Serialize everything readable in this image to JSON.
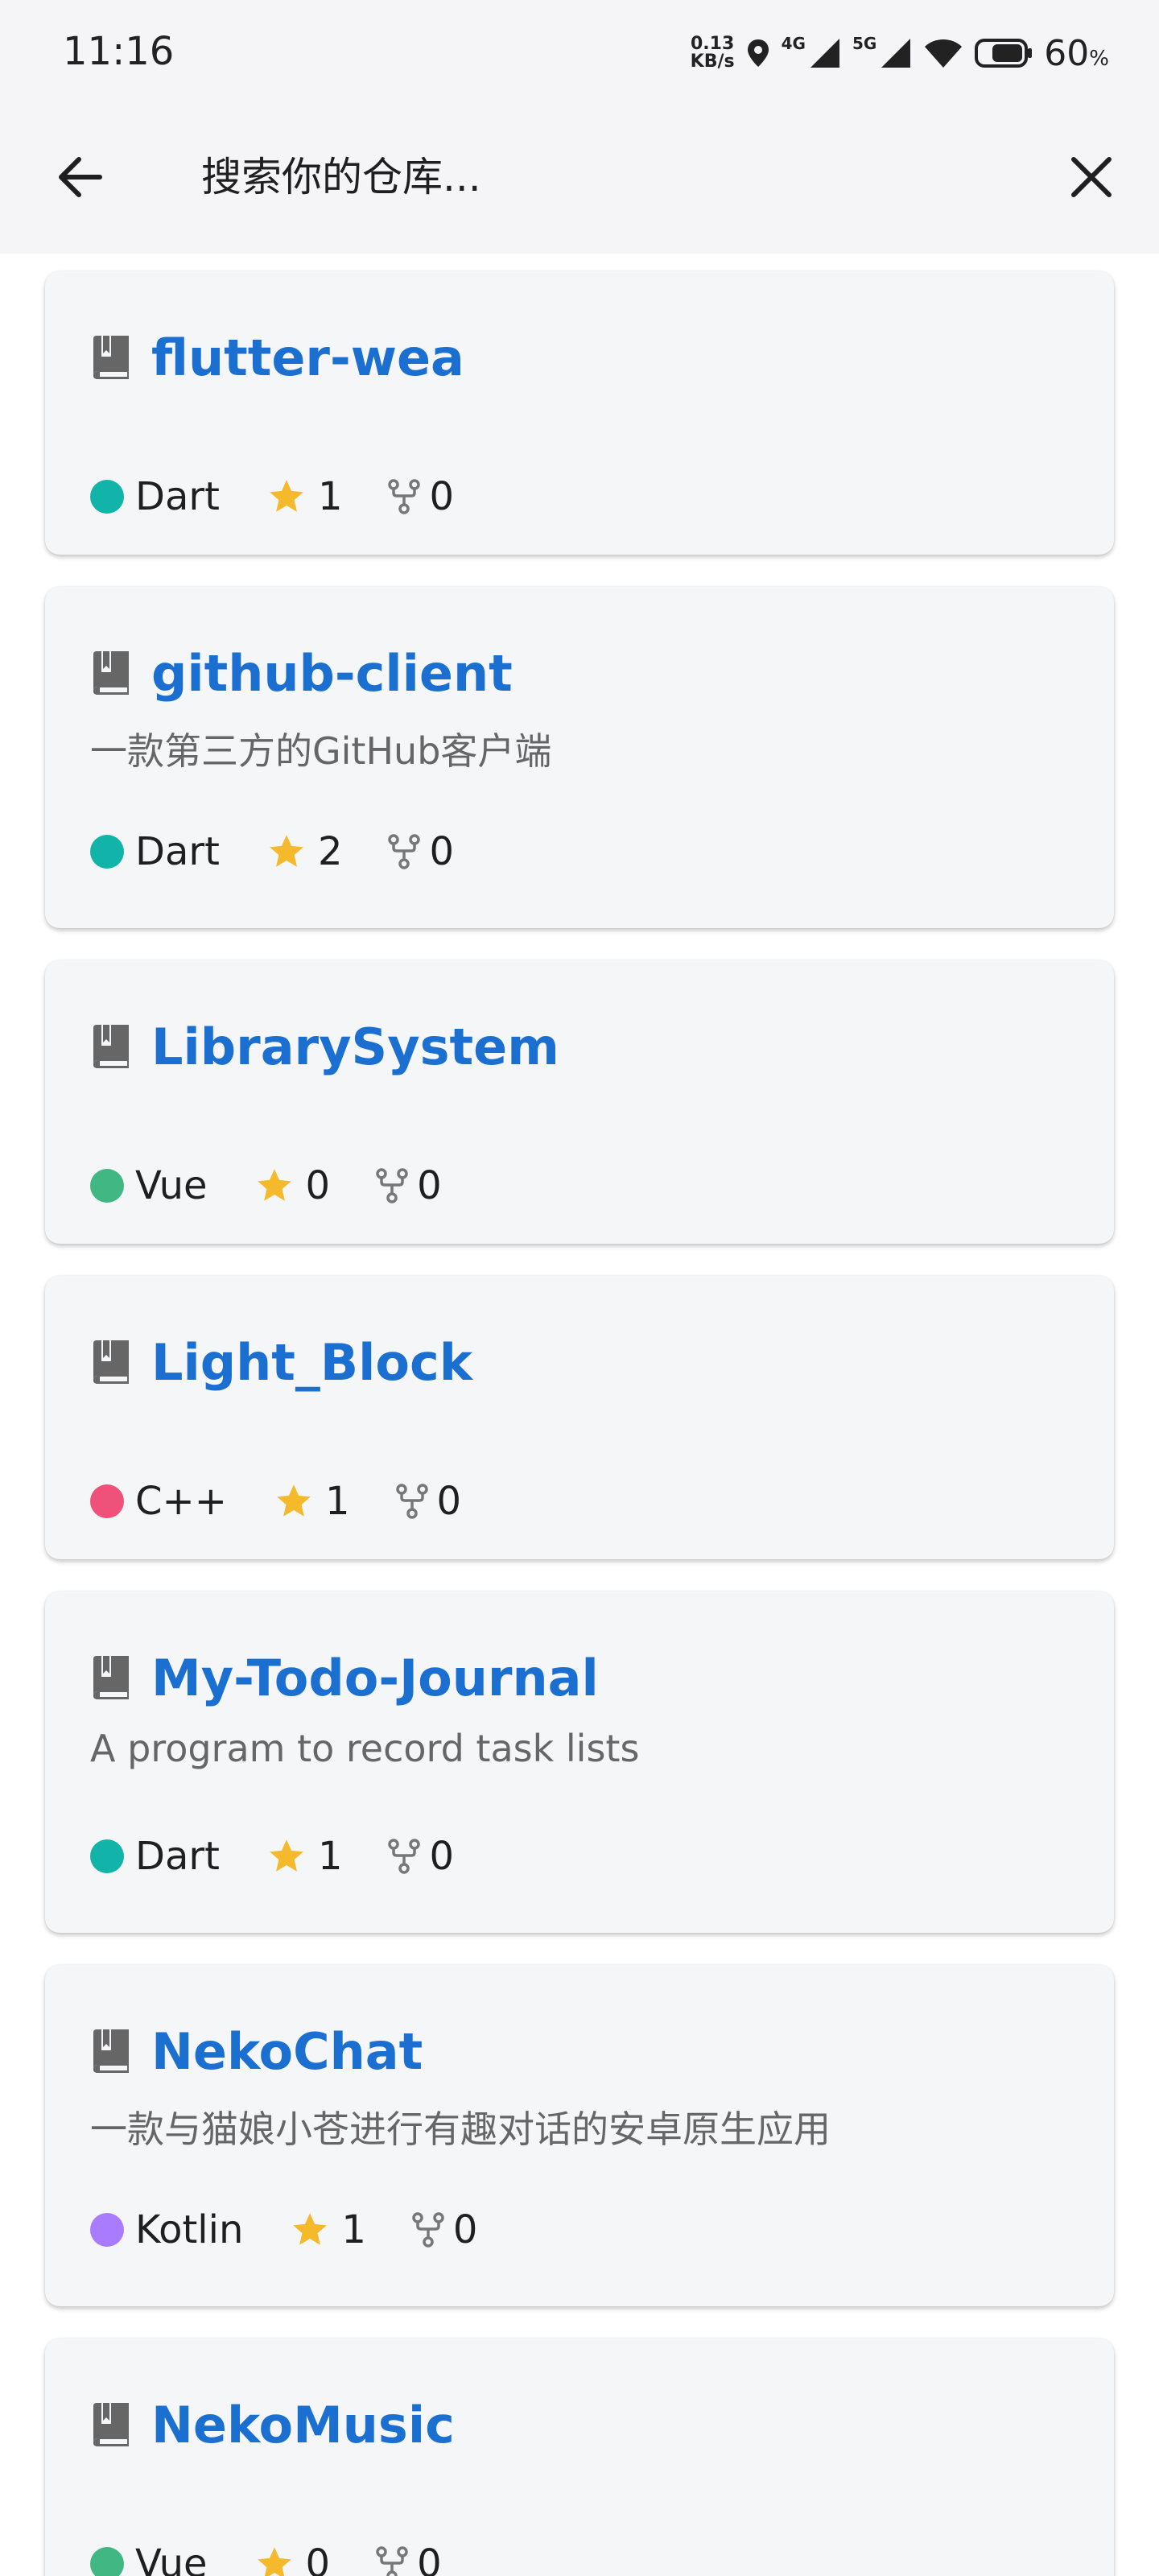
{
  "status_bar": {
    "time": "11:16",
    "net_speed_value": "0.13",
    "net_speed_unit": "KB/s",
    "signal1_label": "4G",
    "signal2_label": "5G",
    "battery_value": "60",
    "battery_unit": "%"
  },
  "search": {
    "placeholder": "搜索你的仓库..."
  },
  "colors": {
    "link": "#1a6fd1",
    "star": "#f5b92c",
    "Dart": "#12b3a8",
    "Vue": "#41b883",
    "C++": "#f0517b",
    "Kotlin": "#a97bff"
  },
  "repos": [
    {
      "name": "flutter-wea",
      "description": "",
      "language": "Dart",
      "lang_color": "#12b3a8",
      "stars": "1",
      "forks": "0"
    },
    {
      "name": "github-client",
      "description": "一款第三方的GitHub客户端",
      "language": "Dart",
      "lang_color": "#12b3a8",
      "stars": "2",
      "forks": "0"
    },
    {
      "name": "LibrarySystem",
      "description": "",
      "language": "Vue",
      "lang_color": "#41b883",
      "stars": "0",
      "forks": "0"
    },
    {
      "name": "Light_Block",
      "description": "",
      "language": "C++",
      "lang_color": "#f0517b",
      "stars": "1",
      "forks": "0"
    },
    {
      "name": "My-Todo-Journal",
      "description": "A program to record task lists",
      "language": "Dart",
      "lang_color": "#12b3a8",
      "stars": "1",
      "forks": "0"
    },
    {
      "name": "NekoChat",
      "description": "一款与猫娘小苍进行有趣对话的安卓原生应用",
      "language": "Kotlin",
      "lang_color": "#a97bff",
      "stars": "1",
      "forks": "0"
    },
    {
      "name": "NekoMusic",
      "description": "",
      "language": "Vue",
      "lang_color": "#41b883",
      "stars": "0",
      "forks": "0"
    }
  ]
}
